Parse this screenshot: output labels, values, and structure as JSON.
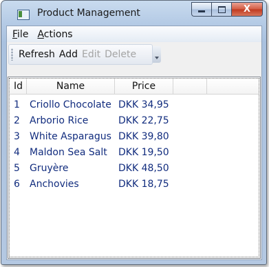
{
  "window": {
    "title": "Product Management",
    "buttons": {
      "minimize": "",
      "maximize": "",
      "close": "X"
    }
  },
  "menu": {
    "items": [
      {
        "label_first": "F",
        "label_rest": "ile"
      },
      {
        "label_first": "A",
        "label_rest": "ctions"
      }
    ]
  },
  "toolbar": {
    "refresh": "Refresh",
    "add": "Add",
    "edit": "Edit",
    "delete": "Delete"
  },
  "table": {
    "columns": [
      "Id",
      "Name",
      "Price"
    ],
    "rows": [
      {
        "id": "1",
        "name": "Criollo Chocolate",
        "price": "DKK 34,95"
      },
      {
        "id": "2",
        "name": "Arborio Rice",
        "price": "DKK 22,75"
      },
      {
        "id": "3",
        "name": "White Asparagus",
        "price": "DKK 39,80"
      },
      {
        "id": "4",
        "name": "Maldon Sea Salt",
        "price": "DKK 19,50"
      },
      {
        "id": "5",
        "name": "Gruyère",
        "price": "DKK 48,50"
      },
      {
        "id": "6",
        "name": "Anchovies",
        "price": "DKK 18,75"
      }
    ]
  },
  "colors": {
    "row_text": "#112c7e",
    "disabled_text": "#a4a4a4",
    "close_button": "#c0391f"
  }
}
